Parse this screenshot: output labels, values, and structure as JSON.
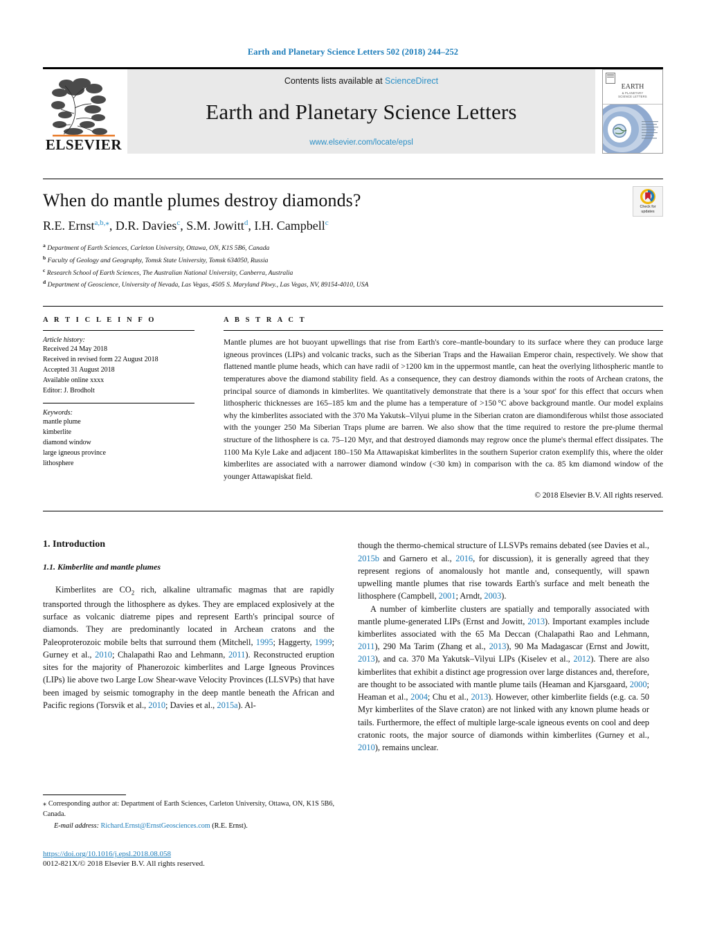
{
  "running_head": "Earth and Planetary Science Letters 502 (2018) 244–252",
  "masthead": {
    "contents_prefix": "Contents lists available at ",
    "sciencedirect": "ScienceDirect",
    "journal_title": "Earth and Planetary Science Letters",
    "journal_url": "www.elsevier.com/locate/epsl",
    "publisher": "ELSEVIER",
    "cover_title": "EARTH",
    "cover_subtitle": "& PLANETARY\nSCIENCE LETTERS",
    "accent_color": "#2a8fc6"
  },
  "article": {
    "title": "When do mantle plumes destroy diamonds?",
    "authors": [
      {
        "name": "R.E. Ernst",
        "marks": "a,b,⁎"
      },
      {
        "name": "D.R. Davies",
        "marks": "c"
      },
      {
        "name": "S.M. Jowitt",
        "marks": "d"
      },
      {
        "name": "I.H. Campbell",
        "marks": "c"
      }
    ],
    "affiliations": [
      {
        "mark": "a",
        "text": "Department of Earth Sciences, Carleton University, Ottawa, ON, K1S 5B6, Canada"
      },
      {
        "mark": "b",
        "text": "Faculty of Geology and Geography, Tomsk State University, Tomsk 634050, Russia"
      },
      {
        "mark": "c",
        "text": "Research School of Earth Sciences, The Australian National University, Canberra, Australia"
      },
      {
        "mark": "d",
        "text": "Department of Geoscience, University of Nevada, Las Vegas, 4505 S. Maryland Pkwy., Las Vegas, NV, 89154-4010, USA"
      }
    ],
    "crossmark_label": "Check for\nupdates"
  },
  "info": {
    "heading": "A R T I C L E   I N F O",
    "history_label": "Article history:",
    "history": [
      "Received 24 May 2018",
      "Received in revised form 22 August 2018",
      "Accepted 31 August 2018",
      "Available online xxxx",
      "Editor: J. Brodholt"
    ],
    "keywords_label": "Keywords:",
    "keywords": [
      "mantle plume",
      "kimberlite",
      "diamond window",
      "large igneous province",
      "lithosphere"
    ]
  },
  "abstract": {
    "heading": "A B S T R A C T",
    "text": "Mantle plumes are hot buoyant upwellings that rise from Earth's core–mantle-boundary to its surface where they can produce large igneous provinces (LIPs) and volcanic tracks, such as the Siberian Traps and the Hawaiian Emperor chain, respectively. We show that flattened mantle plume heads, which can have radii of >1200 km in the uppermost mantle, can heat the overlying lithospheric mantle to temperatures above the diamond stability field. As a consequence, they can destroy diamonds within the roots of Archean cratons, the principal source of diamonds in kimberlites. We quantitatively demonstrate that there is a 'sour spot' for this effect that occurs when lithospheric thicknesses are 165–185 km and the plume has a temperature of >150 °C above background mantle. Our model explains why the kimberlites associated with the 370 Ma Yakutsk–Vilyui plume in the Siberian craton are diamondiferous whilst those associated with the younger 250 Ma Siberian Traps plume are barren. We also show that the time required to restore the pre-plume thermal structure of the lithosphere is ca. 75–120 Myr, and that destroyed diamonds may regrow once the plume's thermal effect dissipates. The 1100 Ma Kyle Lake and adjacent 180–150 Ma Attawapiskat kimberlites in the southern Superior craton exemplify this, where the older kimberlites are associated with a narrower diamond window (<30 km) in comparison with the ca. 85 km diamond window of the younger Attawapiskat field.",
    "copyright": "© 2018 Elsevier B.V. All rights reserved."
  },
  "body": {
    "section_number_title": "1.  Introduction",
    "subsection_title": "1.1.  Kimberlite and mantle plumes",
    "left_paragraph_segments": [
      {
        "t": "Kimberlites are CO"
      },
      {
        "t": "2",
        "sub": true
      },
      {
        "t": " rich, alkaline ultramafic magmas that are rapidly transported through the lithosphere as dykes. They are emplaced explosively at the surface as volcanic diatreme pipes and represent Earth's principal source of diamonds. They are predominantly located in Archean cratons and the Paleoproterozoic mobile belts that surround them (Mitchell, "
      },
      {
        "t": "1995",
        "link": true
      },
      {
        "t": "; Haggerty, "
      },
      {
        "t": "1999",
        "link": true
      },
      {
        "t": "; Gurney et al., "
      },
      {
        "t": "2010",
        "link": true
      },
      {
        "t": "; Chalapathi Rao and Lehmann, "
      },
      {
        "t": "2011",
        "link": true
      },
      {
        "t": "). Reconstructed eruption sites for the majority of Phanerozoic kimberlites and Large Igneous Provinces (LIPs) lie above two Large Low Shear-wave Velocity Provinces (LLSVPs) that have been imaged by seismic tomography in the deep mantle beneath the African and Pacific regions (Torsvik et al., "
      },
      {
        "t": "2010",
        "link": true
      },
      {
        "t": "; Davies et al., "
      },
      {
        "t": "2015a",
        "link": true
      },
      {
        "t": "). Al-"
      }
    ],
    "right_paragraph_1_segments": [
      {
        "t": "though the thermo-chemical structure of LLSVPs remains debated (see Davies et al., "
      },
      {
        "t": "2015b",
        "link": true
      },
      {
        "t": " and Garnero et al., "
      },
      {
        "t": "2016",
        "link": true
      },
      {
        "t": ", for discussion), it is generally agreed that they represent regions of anomalously hot mantle and, consequently, will spawn upwelling mantle plumes that rise towards Earth's surface and melt beneath the lithosphere (Campbell, "
      },
      {
        "t": "2001",
        "link": true
      },
      {
        "t": "; Arndt, "
      },
      {
        "t": "2003",
        "link": true
      },
      {
        "t": ")."
      }
    ],
    "right_paragraph_2_segments": [
      {
        "t": "A number of kimberlite clusters are spatially and temporally associated with mantle plume-generated LIPs (Ernst and Jowitt, "
      },
      {
        "t": "2013",
        "link": true
      },
      {
        "t": "). Important examples include kimberlites associated with the 65 Ma Deccan (Chalapathi Rao and Lehmann, "
      },
      {
        "t": "2011",
        "link": true
      },
      {
        "t": "), 290 Ma Tarim (Zhang et al., "
      },
      {
        "t": "2013",
        "link": true
      },
      {
        "t": "), 90 Ma Madagascar (Ernst and Jowitt, "
      },
      {
        "t": "2013",
        "link": true
      },
      {
        "t": "), and ca. 370 Ma Yakutsk–Vilyui LIPs (Kiselev et al., "
      },
      {
        "t": "2012",
        "link": true
      },
      {
        "t": "). There are also kimberlites that exhibit a distinct age progression over large distances and, therefore, are thought to be associated with mantle plume tails (Heaman and Kjarsgaard, "
      },
      {
        "t": "2000",
        "link": true
      },
      {
        "t": "; Heaman et al., "
      },
      {
        "t": "2004",
        "link": true
      },
      {
        "t": "; Chu et al., "
      },
      {
        "t": "2013",
        "link": true
      },
      {
        "t": "). However, other kimberlite fields (e.g. ca. 50 Myr kimberlites of the Slave craton) are not linked with any known plume heads or tails. Furthermore, the effect of multiple large-scale igneous events on cool and deep cratonic roots, the major source of diamonds within kimberlites (Gurney et al., "
      },
      {
        "t": "2010",
        "link": true
      },
      {
        "t": "), remains unclear."
      }
    ]
  },
  "footer": {
    "corresponding_mark": "⁎",
    "corresponding_text": "Corresponding author at: Department of Earth Sciences, Carleton University, Ottawa, ON, K1S 5B6, Canada.",
    "email_label": "E-mail address:",
    "email": "Richard.Ernst@ErnstGeosciences.com",
    "email_suffix": "(R.E. Ernst).",
    "doi": "https://doi.org/10.1016/j.epsl.2018.08.058",
    "issn_line": "0012-821X/© 2018 Elsevier B.V. All rights reserved."
  }
}
